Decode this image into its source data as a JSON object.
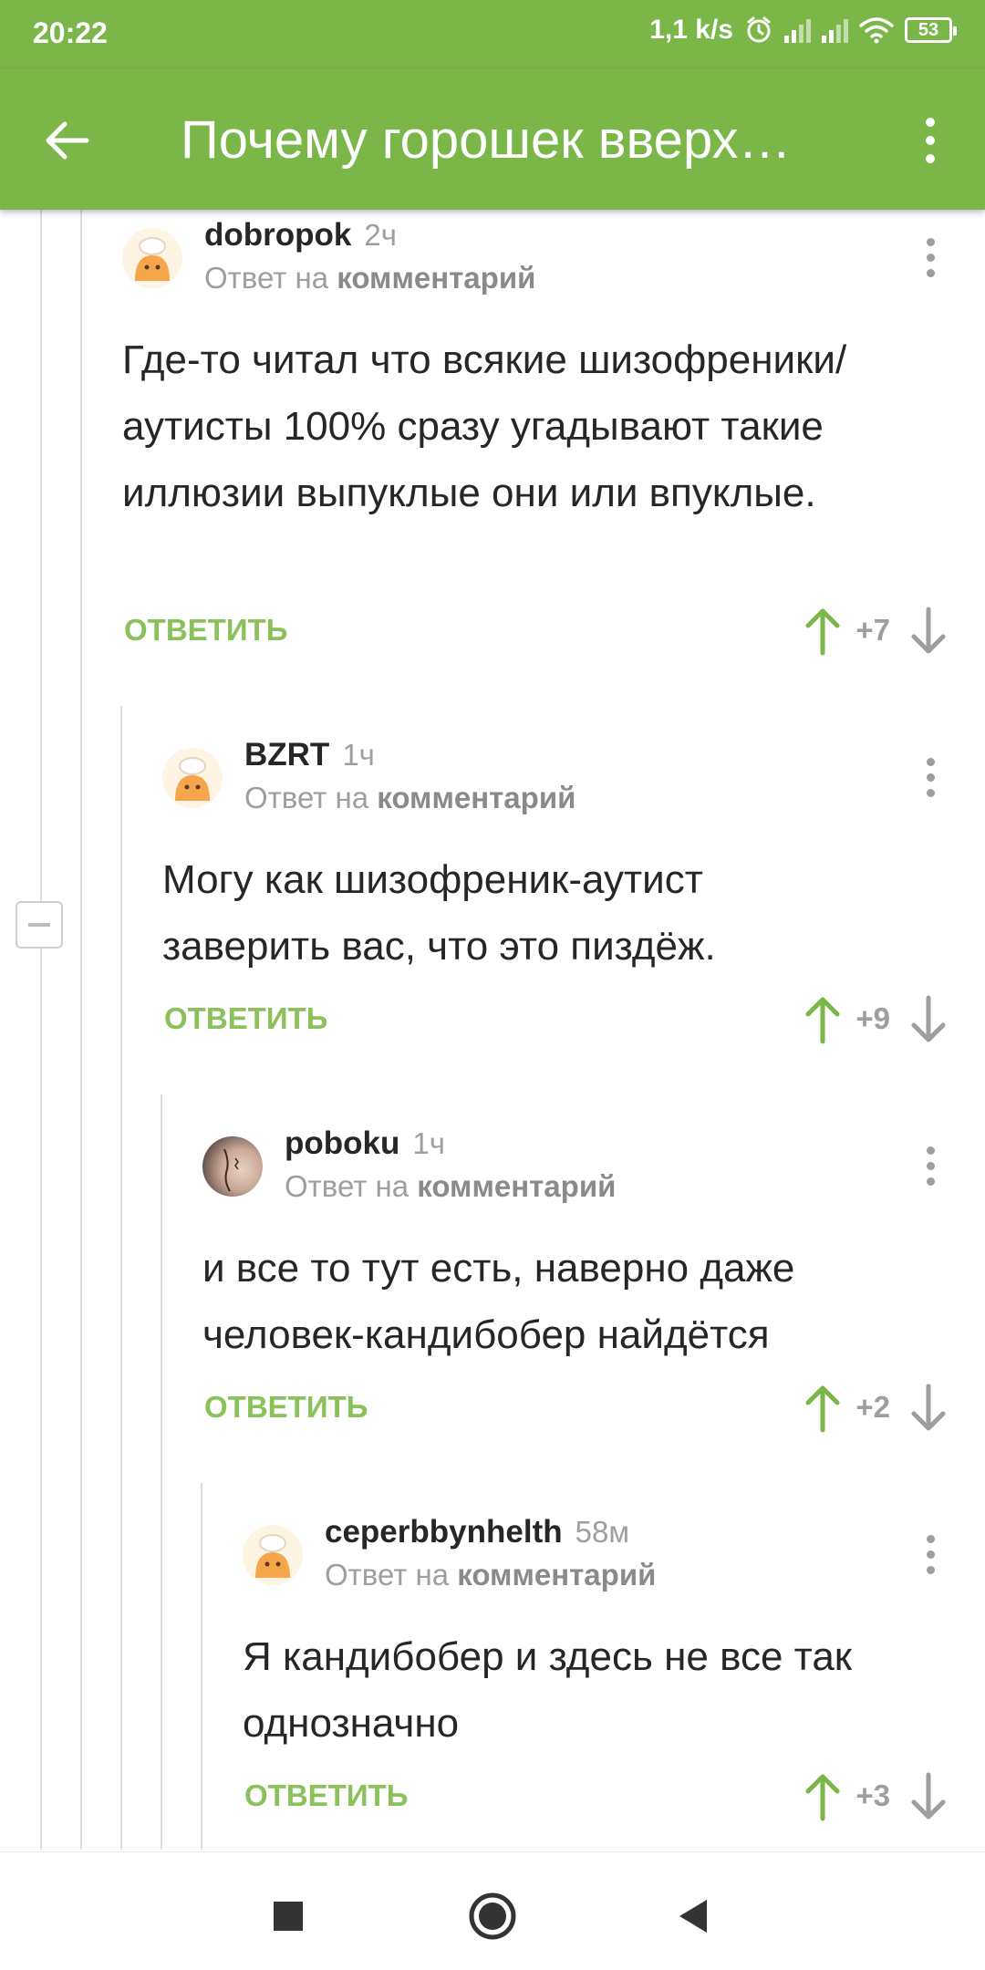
{
  "status_bar": {
    "time": "20:22",
    "speed": "1,1 k/s",
    "battery": "53"
  },
  "app_bar": {
    "title": "Почему горошек вверх…",
    "back_icon": "arrow-left-icon",
    "menu_icon": "more-vertical-icon"
  },
  "comments": [
    {
      "author": "dobropok",
      "time": "2ч",
      "reply_prefix": "Ответ на",
      "reply_target": "комментарий",
      "text": "Где-то читал что всякие шизофреники/аутисты 100% сразу угадывают такие иллюзии выпуклые они или впуклые.",
      "reply_label": "ОТВЕТИТЬ",
      "score": "+7",
      "avatar": "chef-avatar"
    },
    {
      "author": "BZRT",
      "time": "1ч",
      "reply_prefix": "Ответ на",
      "reply_target": "комментарий",
      "text": "Могу как шизофреник-аутист заверить вас, что это пиздёж.",
      "reply_label": "ОТВЕТИТЬ",
      "score": "+9",
      "avatar": "chef-avatar"
    },
    {
      "author": "poboku",
      "time": "1ч",
      "reply_prefix": "Ответ на",
      "reply_target": "комментарий",
      "text": "и все то тут есть, наверно даже человек-кандибобер найдётся",
      "reply_label": "ОТВЕТИТЬ",
      "score": "+2",
      "avatar": "photo-avatar"
    },
    {
      "author": "ceperbbynhelth",
      "time": "58м",
      "reply_prefix": "Ответ на",
      "reply_target": "комментарий",
      "text": "Я кандибобер и здесь не все так однозначно",
      "reply_label": "ОТВЕТИТЬ",
      "score": "+3",
      "avatar": "chef-avatar"
    }
  ],
  "colors": {
    "accent": "#7ab648",
    "reply": "#8ac15a",
    "muted": "#9e9e9e"
  },
  "nav_bar": {
    "icons": [
      "recents-square-icon",
      "home-circle-icon",
      "back-triangle-icon"
    ]
  }
}
